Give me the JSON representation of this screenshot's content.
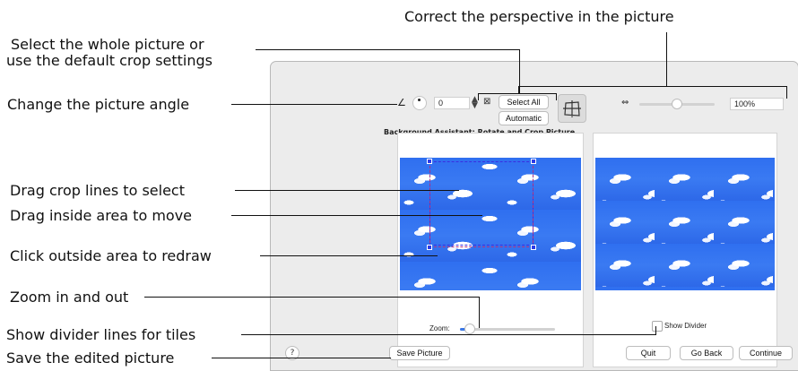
{
  "callouts": {
    "perspective": "Correct the perspective in the picture",
    "select_whole_1": "Select the whole picture or",
    "select_whole_2": "use the default crop settings",
    "angle": "Change the picture angle",
    "drag_crop": "Drag crop lines to select",
    "drag_inside": "Drag inside area to move",
    "click_outside": "Click outside area to redraw",
    "zoom": "Zoom in and out",
    "show_divider": "Show divider lines for tiles",
    "save": "Save the edited picture"
  },
  "dialog": {
    "title": "Background Assistant: Rotate and Crop Picture",
    "angle_value": "0",
    "select_all_label": "Select All",
    "automatic_label": "Automatic",
    "zoom_percent": "100%",
    "zoom_label": "Zoom:",
    "show_divider_label": "Show Divider",
    "show_divider_checked": false,
    "help_label": "?",
    "save_picture_label": "Save Picture",
    "quit_label": "Quit",
    "go_back_label": "Go Back",
    "continue_label": "Continue",
    "zoom_level_fraction": 0.1,
    "perspective_level_fraction": 0.5
  }
}
